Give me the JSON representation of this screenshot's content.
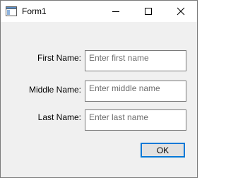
{
  "window": {
    "title": "Form1"
  },
  "form": {
    "first_name": {
      "label": "First Name:",
      "placeholder": "Enter first name"
    },
    "middle_name": {
      "label": "Middle Name:",
      "placeholder": "Enter middle name"
    },
    "last_name": {
      "label": "Last Name:",
      "placeholder": "Enter last name"
    },
    "ok_label": "OK"
  },
  "icons": {
    "app": "form-window-icon",
    "minimize": "minimize-icon",
    "maximize": "maximize-icon",
    "close": "close-icon"
  },
  "colors": {
    "accent": "#0078d7",
    "window_bg": "#f0f0f0",
    "border": "#7a7a7a",
    "placeholder_text": "#6d6d6d"
  }
}
